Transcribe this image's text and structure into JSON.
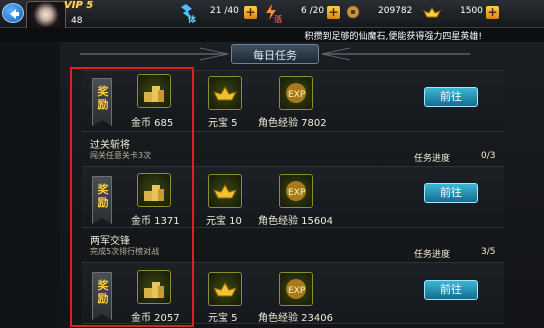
{
  "topbar": {
    "vip": "VIP 5",
    "level": "48",
    "stamina_label": "体",
    "stamina": "21 /40",
    "energy_label": "活",
    "energy": "6 /20",
    "coins": "209782",
    "gold": "1500"
  },
  "ticker": "积攒到足够的仙魔石,便能获得强力四星英雄!",
  "header": {
    "title": "每日任务"
  },
  "rewards_label": "奖励",
  "tasks": [
    {
      "title": "",
      "desc": "",
      "progress_label": "",
      "progress": "",
      "coin": "金币 685",
      "yuanbao": "元宝 5",
      "exp": "角色经验 7802",
      "button": "前往"
    },
    {
      "title": "过关斩将",
      "desc": "闯关任意关卡3次",
      "progress_label": "任务进度",
      "progress": "0/3",
      "coin": "金币 1371",
      "yuanbao": "元宝 10",
      "exp": "角色经验 15604",
      "button": "前往"
    },
    {
      "title": "两军交锋",
      "desc": "完成5次排行榜对战",
      "progress_label": "任务进度",
      "progress": "3/5",
      "coin": "金币 2057",
      "yuanbao": "元宝 5",
      "exp": "角色经验 23406",
      "button": "前往"
    }
  ],
  "icons": {
    "coin_item": "coin-stack-icon",
    "yuanbao_item": "gold-ingot-icon",
    "exp_item": "exp-orb-icon"
  },
  "colors": {
    "accent_button": "#2a9fc4",
    "highlight_box": "#e02020",
    "reward_text": "#ffd040"
  }
}
